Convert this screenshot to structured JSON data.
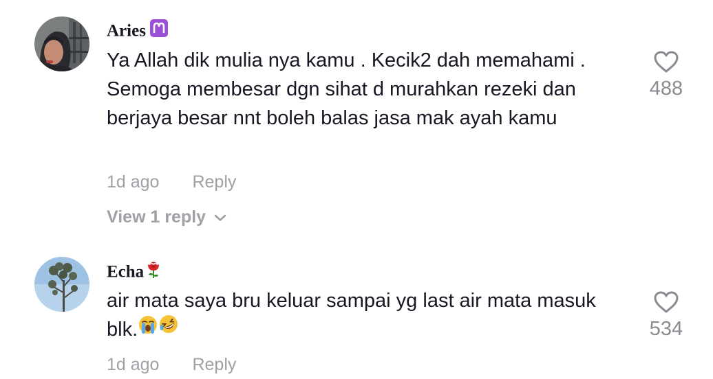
{
  "comments": [
    {
      "username": "Aries",
      "username_badge": "aries-zodiac-icon",
      "text": "Ya Allah dik mulia nya kamu . Kecik2 dah memahami . Semoga membesar dgn sihat d murahkan rezeki dan berjaya besar nnt boleh balas jasa mak ayah kamu",
      "time": "1d ago",
      "reply_label": "Reply",
      "view_replies_label": "View 1 reply",
      "likes": "488"
    },
    {
      "username": "Echa",
      "username_badge": "rose-icon",
      "text": "air mata saya bru keluar sampai yg last air mata masuk blk.",
      "text_emojis": [
        "loudly-crying-face-icon",
        "rolling-on-floor-laughing-icon"
      ],
      "time": "1d ago",
      "reply_label": "Reply",
      "likes": "534"
    }
  ],
  "colors": {
    "primary_text": "#161823",
    "secondary_text": "#a0a0a6",
    "like_count": "#8a8b91",
    "aries_badge": "#9b4fd6"
  }
}
